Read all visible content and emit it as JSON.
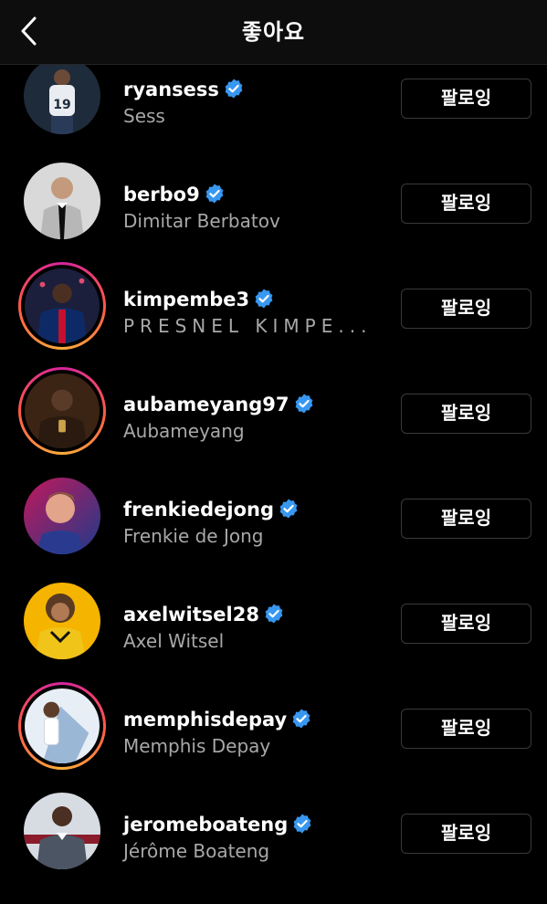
{
  "header": {
    "title": "좋아요",
    "back_icon": "chevron-left-icon"
  },
  "follow_label": "팔로잉",
  "users": [
    {
      "username": "ryansess",
      "full_name": "Sess",
      "verified": true,
      "story": false,
      "avatar_colors": [
        "#1e2b3a",
        "#c9d1dc"
      ]
    },
    {
      "username": "berbo9",
      "full_name": "Dimitar Berbatov",
      "verified": true,
      "story": false,
      "avatar_colors": [
        "#d9d9d9",
        "#b7b7b7"
      ]
    },
    {
      "username": "kimpembe3",
      "full_name": "PRESNEL KIMPE...",
      "verified": true,
      "story": true,
      "avatar_colors": [
        "#1b1f3b",
        "#0e2a66"
      ]
    },
    {
      "username": "aubameyang97",
      "full_name": "Aubameyang",
      "verified": true,
      "story": true,
      "avatar_colors": [
        "#3b2414",
        "#6b4323"
      ]
    },
    {
      "username": "frenkiedejong",
      "full_name": "Frenkie de Jong",
      "verified": true,
      "story": false,
      "avatar_colors": [
        "#c2185b",
        "#1e3a8a"
      ]
    },
    {
      "username": "axelwitsel28",
      "full_name": "Axel Witsel",
      "verified": true,
      "story": false,
      "avatar_colors": [
        "#f5b400",
        "#f0c419"
      ]
    },
    {
      "username": "memphisdepay",
      "full_name": "Memphis Depay",
      "verified": true,
      "story": true,
      "avatar_colors": [
        "#e8eef5",
        "#9bb7d6"
      ]
    },
    {
      "username": "jeromeboateng",
      "full_name": "Jérôme Boateng",
      "verified": true,
      "story": false,
      "avatar_colors": [
        "#d7dce3",
        "#8a1c2b"
      ]
    }
  ]
}
